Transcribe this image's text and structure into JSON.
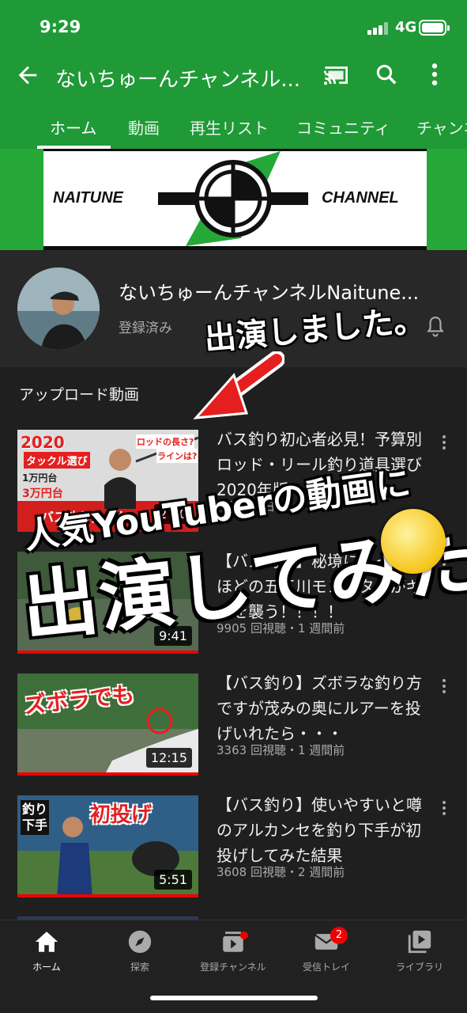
{
  "status_bar": {
    "time": "9:29",
    "network": "4G"
  },
  "app_bar": {
    "channel_title": "ないちゅーんチャンネル...",
    "tabs": [
      "ホーム",
      "動画",
      "再生リスト",
      "コミュニティ",
      "チャンネ"
    ]
  },
  "banner": {
    "left_text": "NAITUNE",
    "right_text": "CHANNEL"
  },
  "channel": {
    "name": "ないちゅーんチャンネルNaitune...",
    "subscribed_label": "登録済み"
  },
  "section_title": "アップロード動画",
  "videos": [
    {
      "title": "バス釣り初心者必見！予算別ロッド・リール釣り道具選び2020年版",
      "meta": "視聴・1 日前",
      "duration": "27:0",
      "thumb_texts": [
        "2020",
        "タックル選び",
        "1万円台",
        "3万円台",
        "ロッドの長さ?",
        "ラインは?",
        "バス釣り始めれ"
      ]
    },
    {
      "title": "【バス釣り】秘境に入ったらほどの五三川モンスターがギルを襲う！！！！",
      "meta": "9905 回視聴・1 週間前",
      "duration": "9:41",
      "thumb_texts": []
    },
    {
      "title": "【バス釣り】ズボラな釣り方ですが茂みの奥にルアーを投げいれたら・・・",
      "meta": "3363 回視聴・1 週間前",
      "duration": "12:15",
      "thumb_texts": [
        "ズボラでも"
      ]
    },
    {
      "title": "【バス釣り】使いやすいと噂のアルカンセを釣り下手が初投げしてみた結果",
      "meta": "3608 回視聴・2 週間前",
      "duration": "5:51",
      "thumb_texts": [
        "釣り下手",
        "初投げ"
      ]
    }
  ],
  "overlays": {
    "appeared": "出演しました。",
    "popular": "人気YouTuberの動画に",
    "tried": "出演してみた"
  },
  "bottom_nav": [
    {
      "label": "ホーム",
      "icon": "home-icon"
    },
    {
      "label": "探索",
      "icon": "explore-icon"
    },
    {
      "label": "登録チャンネル",
      "icon": "subscriptions-icon"
    },
    {
      "label": "受信トレイ",
      "icon": "inbox-icon",
      "badge": "2"
    },
    {
      "label": "ライブラリ",
      "icon": "library-icon"
    }
  ],
  "colors": {
    "brand_green": "#1f9a37",
    "background": "#1f1f1f",
    "progress_red": "#e00000"
  }
}
